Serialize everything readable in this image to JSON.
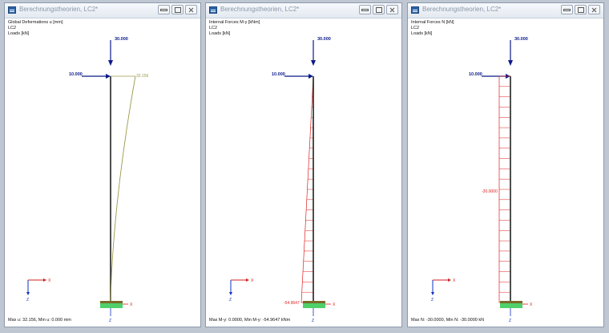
{
  "windows": [
    {
      "title": "Berechnungstheorien, LC2*",
      "info": [
        "Global Deformations u [mm]",
        "LC2",
        "Loads [kN]"
      ],
      "load_vertical": "30.000",
      "load_horizontal": "10.000",
      "result_label": "32.156",
      "status": "Max u: 32.156, Min u: 0.000 mm"
    },
    {
      "title": "Berechnungstheorien, LC2*",
      "info": [
        "Internal Forces M-y [kNm]",
        "LC2",
        "Loads [kN]"
      ],
      "load_vertical": "30.000",
      "load_horizontal": "10.000",
      "result_label": "-54.9647",
      "status": "Max M-y: 0.0000, Min M-y: -54.9647 kNm"
    },
    {
      "title": "Berechnungstheorien, LC2*",
      "info": [
        "Internal Forces N [kN]",
        "LC2",
        "Loads [kN]"
      ],
      "load_vertical": "30.000",
      "load_horizontal": "10.000",
      "result_label": "-30.0000",
      "status": "Max N: -30.0000, Min N: -30.0000 kN"
    }
  ],
  "axis_labels": {
    "x": "X",
    "z": "Z"
  },
  "colors": {
    "load": "#0a1a8a",
    "member": "#222222",
    "deformation": "#9a9a4a",
    "internal_force": "#e02020",
    "support": "#4fd06a",
    "x_axis": "#d02020",
    "z_axis": "#1030c0"
  }
}
